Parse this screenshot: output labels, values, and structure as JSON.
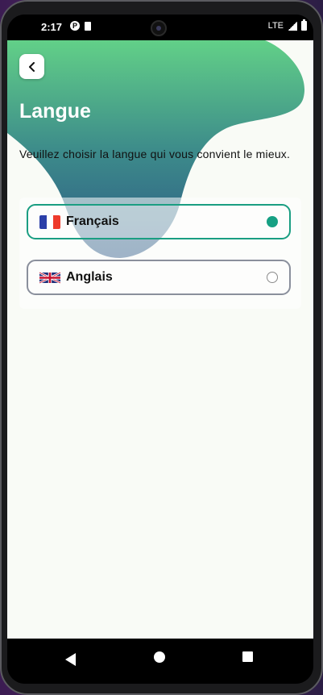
{
  "status_bar": {
    "time": "2:17",
    "network": "LTE",
    "icons": [
      "p-badge-icon",
      "sd-card-icon",
      "signal-icon",
      "battery-icon"
    ]
  },
  "header": {
    "back_icon": "chevron-left-icon",
    "title": "Langue"
  },
  "description": "Veuillez choisir la langue qui vous convient le mieux.",
  "languages": [
    {
      "label": "Français",
      "flag": "france-flag-icon",
      "selected": true
    },
    {
      "label": "Anglais",
      "flag": "uk-flag-icon",
      "selected": false
    }
  ],
  "colors": {
    "accent": "#16a083",
    "blob_top": "#5ccf85",
    "blob_bottom": "#2f5f88",
    "screen_bg": "#f9fbf6"
  },
  "nav_bar": {
    "icons": [
      "nav-back-icon",
      "nav-home-icon",
      "nav-recent-icon"
    ]
  }
}
